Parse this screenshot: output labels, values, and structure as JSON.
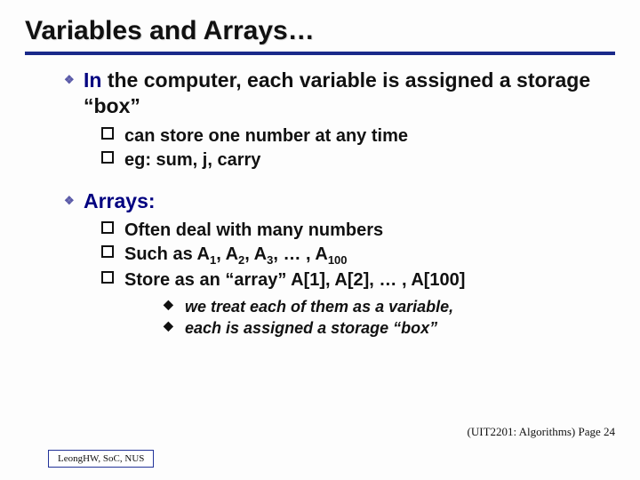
{
  "title": "Variables and Arrays…",
  "section1": {
    "heading_prefix": "In",
    "heading_rest": " the computer, each variable is assigned a storage “box”",
    "items": [
      "can store one number at any time",
      "eg: sum, j, carry"
    ]
  },
  "section2": {
    "heading": "Arrays:",
    "item1": "Often deal with many numbers",
    "item2": {
      "pre": "Such as  A",
      "s1": "1",
      "mid1": ", A",
      "s2": "2",
      "mid2": ", A",
      "s3": "3",
      "mid3": ", … , A",
      "s4": "100"
    },
    "item3": "Store as an “array” A[1], A[2], … , A[100]",
    "sub": [
      "we treat each of them as a variable,",
      "each is assigned a storage “box”"
    ]
  },
  "footer": {
    "right": "(UIT2201: Algorithms) Page 24",
    "left": "LeongHW, SoC, NUS"
  }
}
